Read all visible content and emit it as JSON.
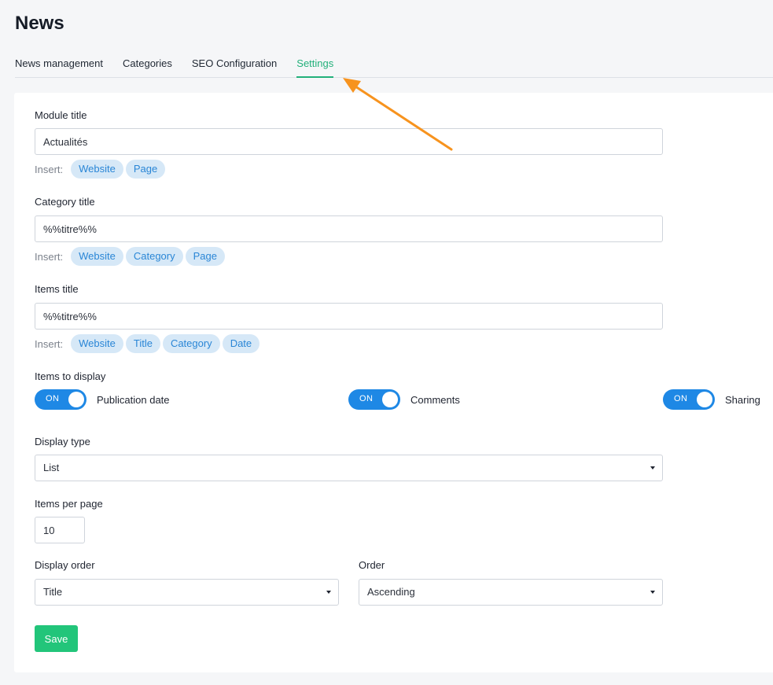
{
  "header": {
    "title": "News"
  },
  "tabs": [
    {
      "label": "News management"
    },
    {
      "label": "Categories"
    },
    {
      "label": "SEO Configuration"
    },
    {
      "label": "Settings"
    }
  ],
  "form": {
    "insert_label": "Insert:",
    "module_title": {
      "label": "Module title",
      "value": "Actualités",
      "chips": [
        "Website",
        "Page"
      ]
    },
    "category_title": {
      "label": "Category title",
      "value": "%%titre%%",
      "chips": [
        "Website",
        "Category",
        "Page"
      ]
    },
    "items_title": {
      "label": "Items title",
      "value": "%%titre%%",
      "chips": [
        "Website",
        "Title",
        "Category",
        "Date"
      ]
    },
    "items_to_display": {
      "label": "Items to display",
      "toggles": [
        {
          "state": "ON",
          "label": "Publication date"
        },
        {
          "state": "ON",
          "label": "Comments"
        },
        {
          "state": "ON",
          "label": "Sharing"
        }
      ]
    },
    "display_type": {
      "label": "Display type",
      "value": "List"
    },
    "items_per_page": {
      "label": "Items per page",
      "value": "10"
    },
    "display_order": {
      "label": "Display order",
      "value": "Title"
    },
    "order": {
      "label": "Order",
      "value": "Ascending"
    },
    "save_label": "Save"
  },
  "colors": {
    "accent": "#22b07a",
    "toggle_on": "#1e88e5",
    "chip_bg": "#d6e8f7",
    "chip_text": "#2a86d6",
    "save_button": "#22c57a",
    "annotation_arrow": "#f7931e"
  }
}
